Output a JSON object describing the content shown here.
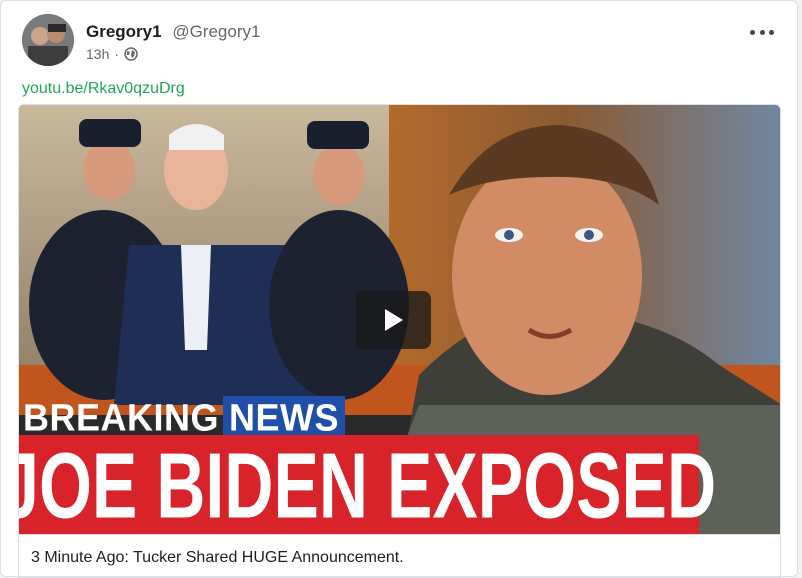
{
  "post": {
    "author_name": "Gregory1",
    "author_handle": "@Gregory1",
    "timestamp": "13h",
    "separator": "·",
    "visibility_icon": "globe-icon",
    "more_icon": "more-options-icon",
    "link_text": "youtu.be/Rkav0qzuDrg",
    "link_color": "#1da851"
  },
  "video": {
    "breaking_label_1": "BREAKING",
    "breaking_label_2": "NEWS",
    "headline": "JOE BIDEN EXPOSED",
    "headline_bg": "#d8232a",
    "news_bg": "#1f4fa8",
    "play_icon": "play-icon"
  },
  "caption": "3 Minute Ago: Tucker Shared HUGE Announcement."
}
